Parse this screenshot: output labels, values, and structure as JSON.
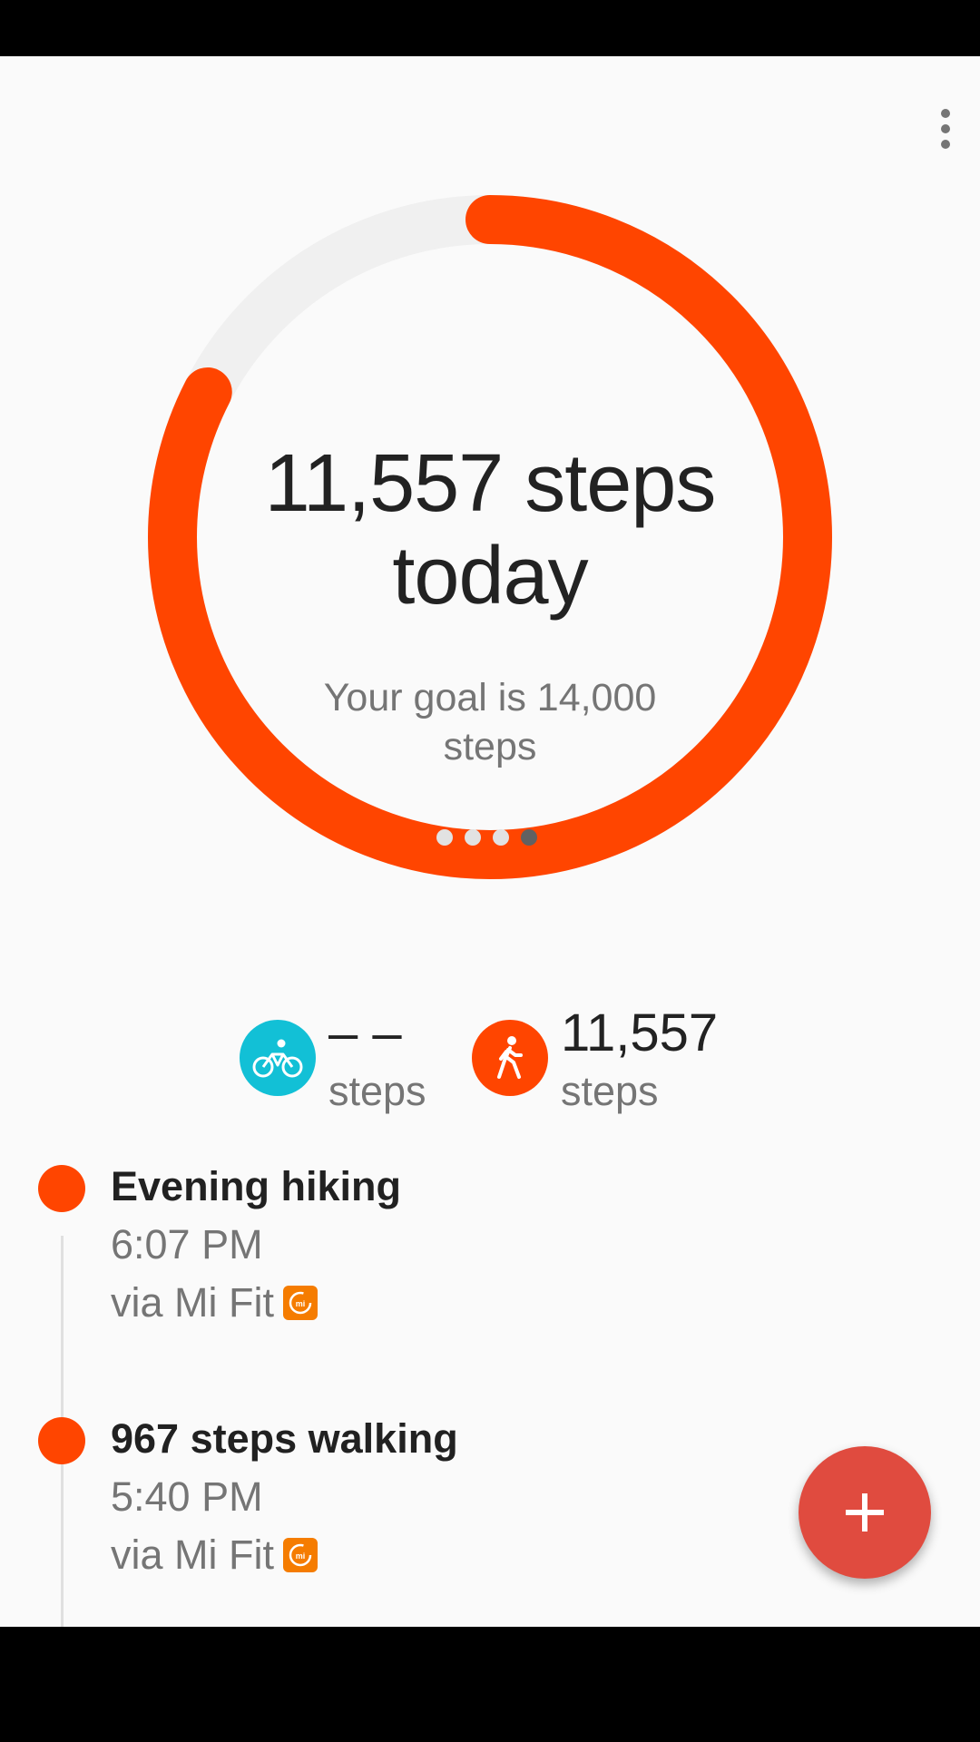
{
  "colors": {
    "accent": "#ff4500",
    "track": "#f0f0f0",
    "cycling": "#12c0d6",
    "walking": "#ff4500",
    "fab": "#e04b3f",
    "mi_badge": "#f57c00"
  },
  "summary": {
    "steps_line1": "11,557 steps",
    "steps_line2": "today",
    "goal_text": "Your goal is 14,000 steps",
    "progress_fraction": 0.8255,
    "page_indicator": {
      "count": 4,
      "active_index": 3
    }
  },
  "activities": {
    "cycling": {
      "icon": "bike-icon",
      "value": "– –",
      "unit": "steps"
    },
    "walking": {
      "icon": "walking-icon",
      "value": "11,557",
      "unit": "steps"
    }
  },
  "timeline": [
    {
      "title": "Evening hiking",
      "time": "6:07 PM",
      "source": "via Mi Fit",
      "source_icon": "mi-fit-icon"
    },
    {
      "title": "967 steps walking",
      "time": "5:40 PM",
      "source": "via Mi Fit",
      "source_icon": "mi-fit-icon"
    }
  ],
  "menu": {
    "icon": "more-vert-icon"
  },
  "fab": {
    "icon": "plus-icon",
    "label": "+"
  }
}
